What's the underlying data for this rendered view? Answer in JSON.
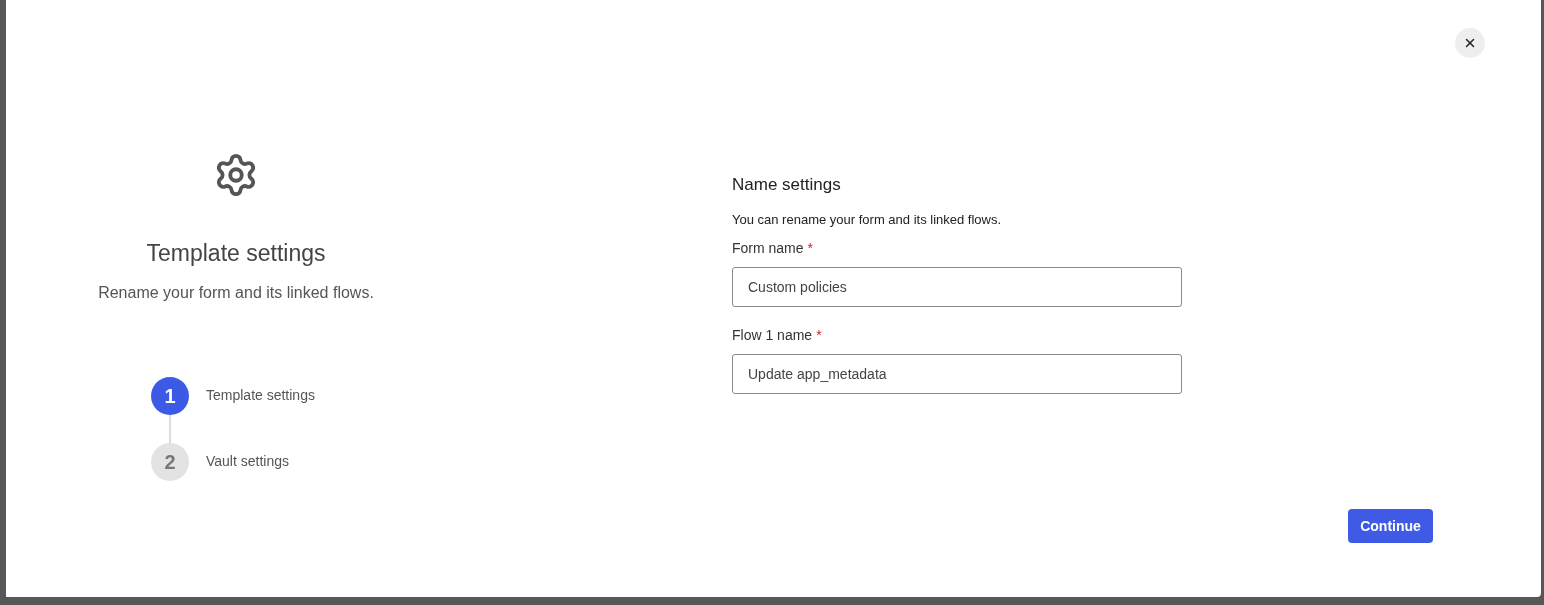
{
  "intro": {
    "title": "Template settings",
    "subtitle": "Rename your form and its linked flows."
  },
  "steps": [
    {
      "number": "1",
      "label": "Template settings",
      "selected": true
    },
    {
      "number": "2",
      "label": "Vault settings",
      "selected": false
    }
  ],
  "section": {
    "title": "Name settings",
    "description": "You can rename your form and its linked flows."
  },
  "fields": [
    {
      "label": "Form name",
      "required_mark": "*",
      "value": "Custom policies"
    },
    {
      "label": "Flow 1 name",
      "required_mark": "*",
      "value": "Update app_metadata"
    }
  ],
  "primary_button": "Continue"
}
